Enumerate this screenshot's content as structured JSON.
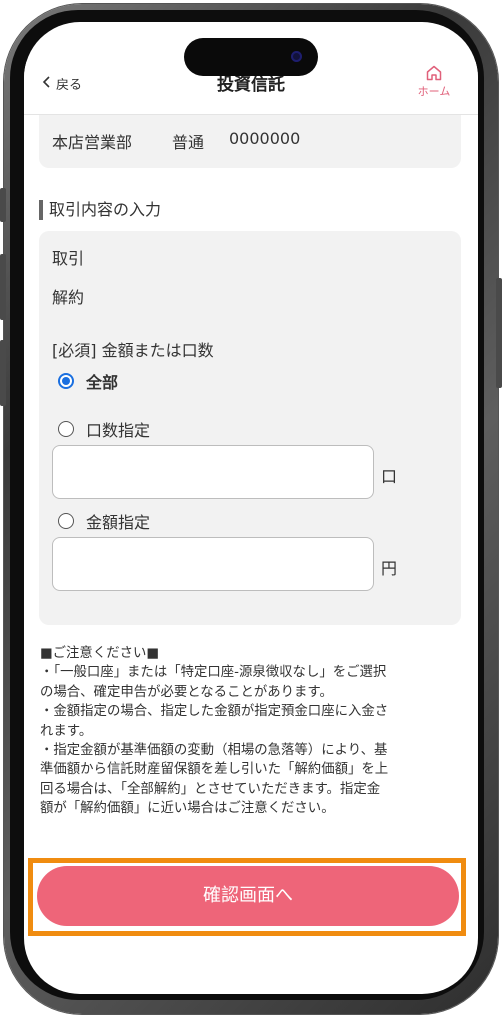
{
  "header": {
    "back_label": "戻る",
    "title": "投資信託",
    "home_label": "ホーム"
  },
  "account": {
    "branch": "本店営業部",
    "type": "普通",
    "number": "0000000"
  },
  "section": {
    "title": "取引内容の入力"
  },
  "form": {
    "transaction_label": "取引",
    "transaction_value": "解約",
    "amount_label": "[必須] 金額または口数",
    "options": [
      {
        "label": "全部",
        "selected": true
      },
      {
        "label": "口数指定",
        "selected": false
      },
      {
        "label": "金額指定",
        "selected": false
      }
    ],
    "units_unit": "口",
    "amount_unit": "円",
    "units_value": "",
    "amount_value": ""
  },
  "notes": {
    "heading": "■ご注意ください■",
    "lines": [
      "・「一般口座」または「特定口座-源泉徴収なし」をご選択",
      "の場合、確定申告が必要となることがあります。",
      "・金額指定の場合、指定した金額が指定預金口座に入金さ",
      "れます。",
      "・指定金額が基準価額の変動（相場の急落等）により、基",
      "準価額から信託財産留保額を差し引いた「解約価額」を上",
      "回る場合は、「全部解約」とさせていただきます。指定金",
      "額が「解約価額」に近い場合はご注意ください。"
    ]
  },
  "confirm_button": {
    "label": "確認画面へ"
  },
  "colors": {
    "accent": "#ee6579",
    "highlight": "#f08c10",
    "radio_selected": "#1a6fe0"
  }
}
